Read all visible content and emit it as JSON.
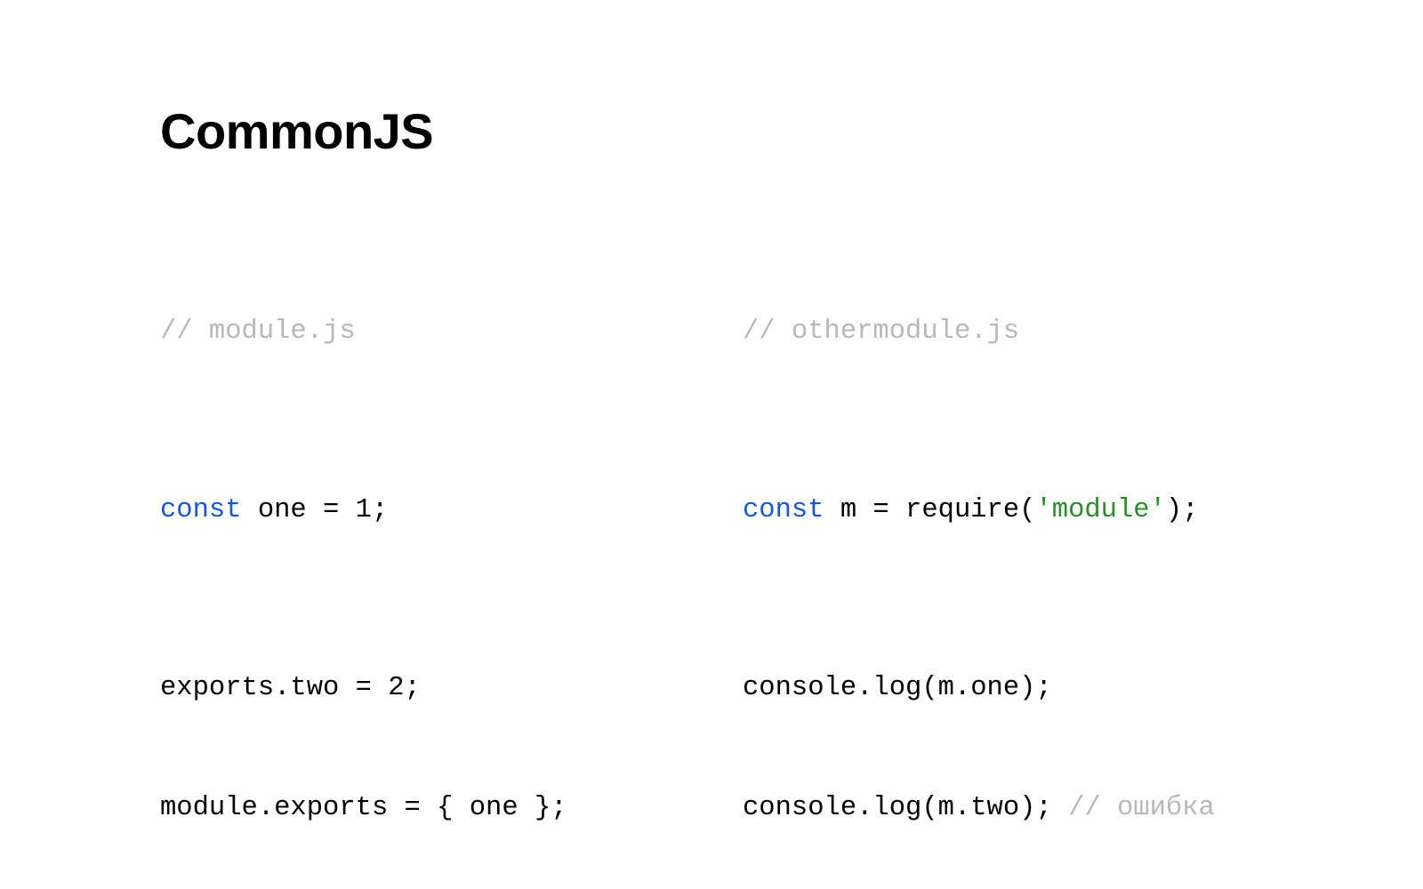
{
  "slide": {
    "title": "CommonJS"
  },
  "code": {
    "left": {
      "comment": "// module.js",
      "line1": {
        "kw": "const",
        "rest": " one = 1;"
      },
      "line2": "exports.two = 2;",
      "line3": "module.exports = { one };"
    },
    "right": {
      "comment": "// othermodule.js",
      "line1": {
        "kw": "const",
        "mid": " m = require(",
        "str": "'module'",
        "end": ");"
      },
      "line2": "console.log(m.one);",
      "line3": {
        "code": "console.log(m.two); ",
        "comment": "// ошибка"
      }
    }
  }
}
